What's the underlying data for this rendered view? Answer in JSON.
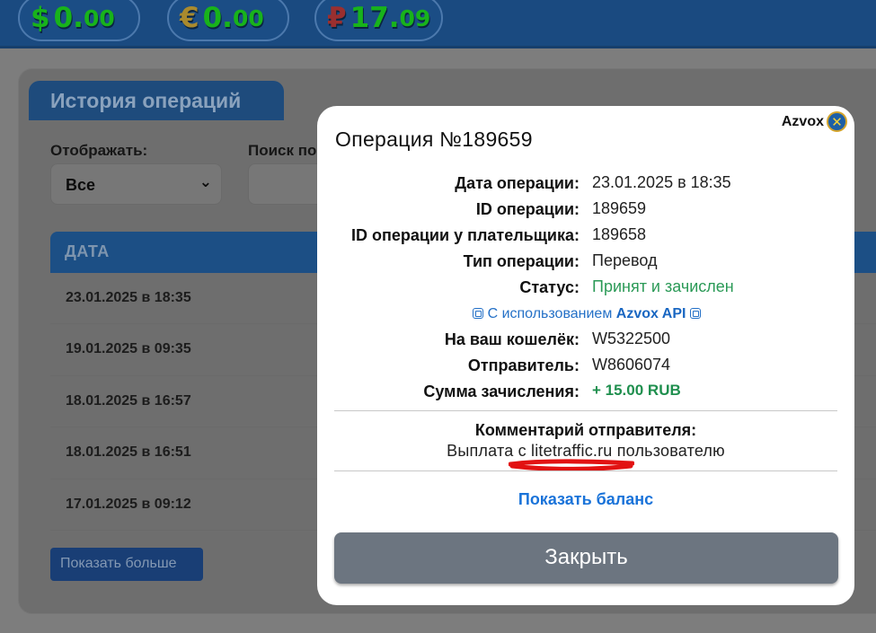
{
  "balances": [
    {
      "symbol": "$",
      "whole": "0.",
      "cents": "00",
      "symbol_color": "#18b31b",
      "value_color": "#18b31b"
    },
    {
      "symbol": "€",
      "whole": "0.",
      "cents": "00",
      "symbol_color": "#a98a2e",
      "value_color": "#18b31b"
    },
    {
      "symbol": "₽",
      "whole": "17.",
      "cents": "09",
      "symbol_color": "#9a2f2f",
      "value_color": "#18b31b"
    }
  ],
  "history": {
    "title": "История операций",
    "filter_label": "Отображать:",
    "filter_value": "Все",
    "search_label": "Поиск по",
    "table_header": "ДАТА",
    "rows": [
      "23.01.2025 в 18:35",
      "19.01.2025 в 09:35",
      "18.01.2025 в 16:57",
      "18.01.2025 в 16:51",
      "17.01.2025 в 09:12"
    ],
    "more_button": "Показать больше"
  },
  "modal": {
    "brand": "Azvox",
    "title": "Операция №189659",
    "fields_top": [
      {
        "key": "Дата операции:",
        "value": "23.01.2025 в 18:35"
      },
      {
        "key": "ID операции:",
        "value": "189659"
      },
      {
        "key": "ID операции у плательщика:",
        "value": "189658"
      },
      {
        "key": "Тип операции:",
        "value": "Перевод"
      },
      {
        "key": "Статус:",
        "value": "Принят и зачислен"
      }
    ],
    "api_note_prefix": "С использованием",
    "api_note_name": "Azvox API",
    "fields_bottom": [
      {
        "key": "На ваш кошелёк:",
        "value": "W5322500"
      },
      {
        "key": "Отправитель:",
        "value": "W8606074"
      },
      {
        "key": "Сумма зачисления:",
        "value": "+ 15.00 RUB"
      }
    ],
    "comment_title": "Комментарий отправителя:",
    "comment_text": "Выплата с litetraffic.ru пользователю",
    "show_balance": "Показать баланс",
    "close_button": "Закрыть"
  },
  "colors": {
    "header_bg": "#1a4a80",
    "status_green": "#2b9a57",
    "link_blue": "#1a73d9",
    "close_btn": "#6c7580",
    "annotation_red": "#e21212"
  },
  "icons": {
    "brand_logo": "azvox-logo-icon",
    "api_chip": "chip-icon",
    "select_chevron": "chevron-down-icon"
  }
}
